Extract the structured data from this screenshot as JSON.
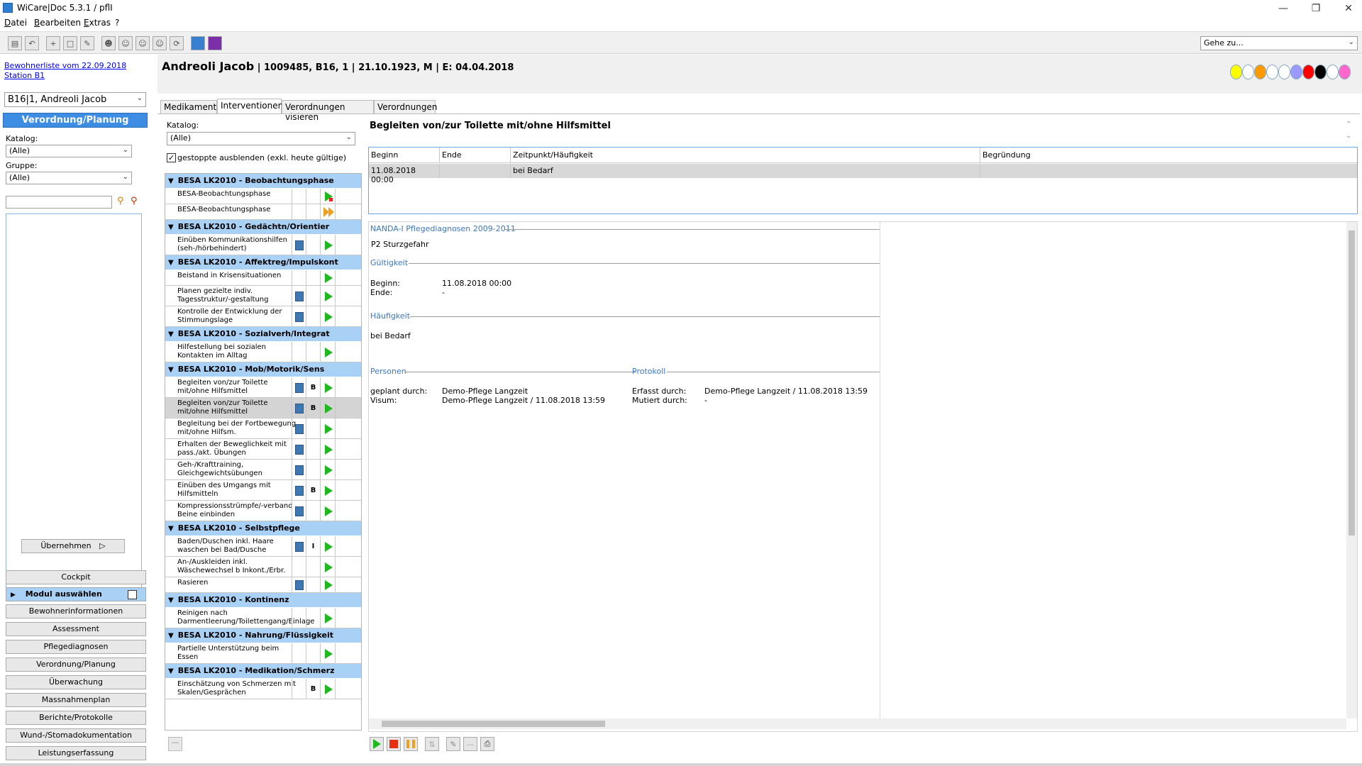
{
  "window": {
    "title": "WiCare|Doc 5.3.1  / pflI"
  },
  "menu": [
    "Datei",
    "Bearbeiten",
    "Extras",
    "?"
  ],
  "toolbar": {
    "goto_placeholder": "Gehe zu..."
  },
  "left": {
    "link1": "Bewohnerliste vom 22.09.2018",
    "link2": "Station B1",
    "resident_select": "B16|1, Andreoli Jacob",
    "section_header": "Verordnung/Planung",
    "katalog_label": "Katalog:",
    "katalog_value": "(Alle)",
    "gruppe_label": "Gruppe:",
    "gruppe_value": "(Alle)",
    "uebernehmen": "Übernehmen",
    "cockpit": "Cockpit",
    "modul": "Modul auswählen",
    "nav": [
      "Bewohnerinformationen",
      "Assessment",
      "Pflegediagnosen",
      "Verordnung/Planung",
      "Überwachung",
      "Massnahmenplan",
      "Berichte/Protokolle",
      "Wund-/Stomadokumentation",
      "Leistungserfassung"
    ]
  },
  "patient": {
    "name": "Andreoli Jacob",
    "info": " | 1009485, B16, 1 | 21.10.1923, M | E: 04.04.2018"
  },
  "status_colors": [
    "#ffff00",
    "#ffffff",
    "#ff9900",
    "#ffffff",
    "#ffffff",
    "#9999ff",
    "#ff0000",
    "#000000",
    "#ffffff",
    "#ff66cc"
  ],
  "tabs": [
    "Medikamente",
    "Interventionen",
    "Verordnungen visieren",
    "Verordnungen"
  ],
  "interventions": {
    "katalog_label": "Katalog:",
    "katalog_value": "(Alle)",
    "checkbox_label": "gestoppte ausblenden (exkl. heute gültige)",
    "groups": [
      {
        "title": "BESA LK2010 - Beobachtungsphase",
        "items": [
          {
            "label": "BESA-Beobachtungsphase",
            "book": false,
            "code": "",
            "status": "play-stop"
          },
          {
            "label": "BESA-Beobachtungsphase",
            "book": false,
            "code": "",
            "status": "ffwd"
          }
        ]
      },
      {
        "title": "BESA LK2010 - Gedächtn/Orientier",
        "items": [
          {
            "label": "Einüben Kommunikationshilfen (seh-/hörbehindert)",
            "book": true,
            "code": "",
            "status": "play"
          }
        ]
      },
      {
        "title": "BESA LK2010 - Affektreg/Impulskont",
        "items": [
          {
            "label": "Beistand in Krisensituationen",
            "book": false,
            "code": "",
            "status": "play"
          },
          {
            "label": "Planen gezielte indiv. Tagesstruktur/-gestaltung",
            "book": true,
            "code": "",
            "status": "play"
          },
          {
            "label": "Kontrolle der Entwicklung der Stimmungslage",
            "book": true,
            "code": "",
            "status": "play"
          }
        ]
      },
      {
        "title": "BESA LK2010 - Sozialverh/Integrat",
        "items": [
          {
            "label": "Hilfestellung bei sozialen Kontakten im Alltag",
            "book": false,
            "code": "",
            "status": "play"
          }
        ]
      },
      {
        "title": "BESA LK2010 - Mob/Motorik/Sens",
        "items": [
          {
            "label": "Begleiten von/zur Toilette mit/ohne Hilfsmittel",
            "book": true,
            "code": "B",
            "status": "play"
          },
          {
            "label": "Begleiten von/zur Toilette mit/ohne Hilfsmittel",
            "book": true,
            "code": "B",
            "status": "play",
            "selected": true
          },
          {
            "label": "Begleitung bei der Fortbewegung mit/ohne Hilfsm.",
            "book": true,
            "code": "",
            "status": "play"
          },
          {
            "label": "Erhalten der Beweglichkeit mit pass./akt. Übungen",
            "book": true,
            "code": "",
            "status": "play"
          },
          {
            "label": "Geh-/Krafttraining, Gleichgewichtsübungen",
            "book": true,
            "code": "",
            "status": "play"
          },
          {
            "label": "Einüben des Umgangs mit Hilfsmitteln",
            "book": true,
            "code": "B",
            "status": "play"
          },
          {
            "label": "Kompressionsstrümpfe/-verband , Beine einbinden",
            "book": true,
            "code": "",
            "status": "play"
          }
        ]
      },
      {
        "title": "BESA LK2010 - Selbstpflege",
        "items": [
          {
            "label": "Baden/Duschen inkl. Haare waschen bei Bad/Dusche",
            "book": true,
            "code": "I",
            "status": "play"
          },
          {
            "label": "An-/Auskleiden inkl. Wäschewechsel b Inkont./Erbr.",
            "book": false,
            "code": "",
            "status": "play"
          },
          {
            "label": "Rasieren",
            "book": true,
            "code": "",
            "status": "play"
          }
        ]
      },
      {
        "title": "BESA LK2010 - Kontinenz",
        "items": [
          {
            "label": "Reinigen nach Darmentleerung/Toilettengang/Einlage",
            "book": false,
            "code": "",
            "status": "play"
          }
        ]
      },
      {
        "title": "BESA LK2010 - Nahrung/Flüssigkeit",
        "items": [
          {
            "label": "Partielle Unterstützung beim Essen",
            "book": false,
            "code": "",
            "status": "play"
          }
        ]
      },
      {
        "title": "BESA LK2010 - Medikation/Schmerz",
        "items": [
          {
            "label": "Einschätzung von Schmerzen mit Skalen/Gesprächen",
            "book": false,
            "code": "B",
            "status": "play"
          }
        ]
      }
    ]
  },
  "detail": {
    "title": "Begleiten von/zur Toilette mit/ohne Hilfsmittel",
    "grid_headers": [
      "Beginn",
      "Ende",
      "Zeitpunkt/Häufigkeit",
      "Begründung"
    ],
    "grid_row": [
      "11.08.2018 00:00",
      "",
      "bei Bedarf",
      ""
    ],
    "nanda_title": "NANDA-I Pflegediagnosen 2009-2011",
    "nanda_value": "P2  Sturzgefahr",
    "gueltigkeit": "Gültigkeit",
    "beginn_label": "Beginn:",
    "beginn_value": "11.08.2018 00:00",
    "ende_label": "Ende:",
    "ende_value": "-",
    "haeufigkeit": "Häufigkeit",
    "haeufigkeit_value": "bei Bedarf",
    "personen": "Personen",
    "protokoll": "Protokoll",
    "geplant_label": "geplant durch:",
    "geplant_value": "Demo-Pflege Langzeit",
    "visum_label": "Visum:",
    "visum_value": "Demo-Pflege Langzeit / 11.08.2018 13:59",
    "erfasst_label": "Erfasst durch:",
    "erfasst_value": "Demo-Pflege Langzeit / 11.08.2018 13:59",
    "mutiert_label": "Mutiert durch:",
    "mutiert_value": "-"
  }
}
